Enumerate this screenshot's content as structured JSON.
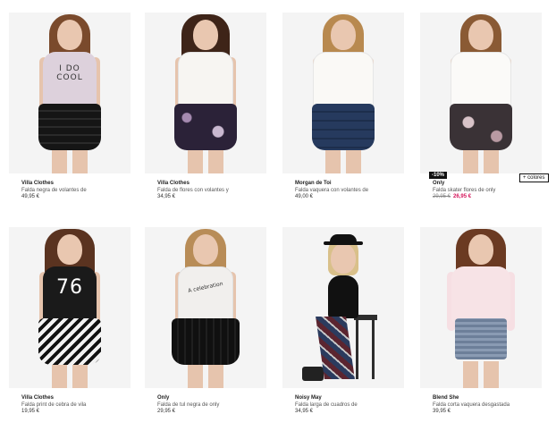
{
  "products": [
    {
      "brand": "Villa Clothes",
      "desc": "Falda negra de volantes de",
      "price": "49,95 €"
    },
    {
      "brand": "Villa Clothes",
      "desc": "Falda de flores con volantes y",
      "price": "34,95 €"
    },
    {
      "brand": "Morgan de Toi",
      "desc": "Falda vaquera con volantes de",
      "price": "49,00 €"
    },
    {
      "brand": "Only",
      "desc": "Falda skater flores de only",
      "old_price": "29,95 €",
      "price": "26,95 €",
      "badge": "-10%",
      "colors_button": "+ colores"
    },
    {
      "brand": "Villa Clothes",
      "desc": "Falda print de cebra de vila",
      "price": "19,95 €"
    },
    {
      "brand": "Only",
      "desc": "Falda de tul negra de only",
      "price": "29,95 €"
    },
    {
      "brand": "Noisy May",
      "desc": "Falda larga de cuadros de",
      "price": "34,95 €"
    },
    {
      "brand": "Blend She",
      "desc": "Falda corta vaquera desgastada",
      "price": "39,95 €"
    }
  ],
  "shirt_prints": {
    "p1": "I DO\nCOOL",
    "p5": "76",
    "p6": "A celebration"
  },
  "colors": {
    "sale": "#d4145a",
    "badge_bg": "#111111",
    "photo_bg": "#f4f4f4"
  }
}
